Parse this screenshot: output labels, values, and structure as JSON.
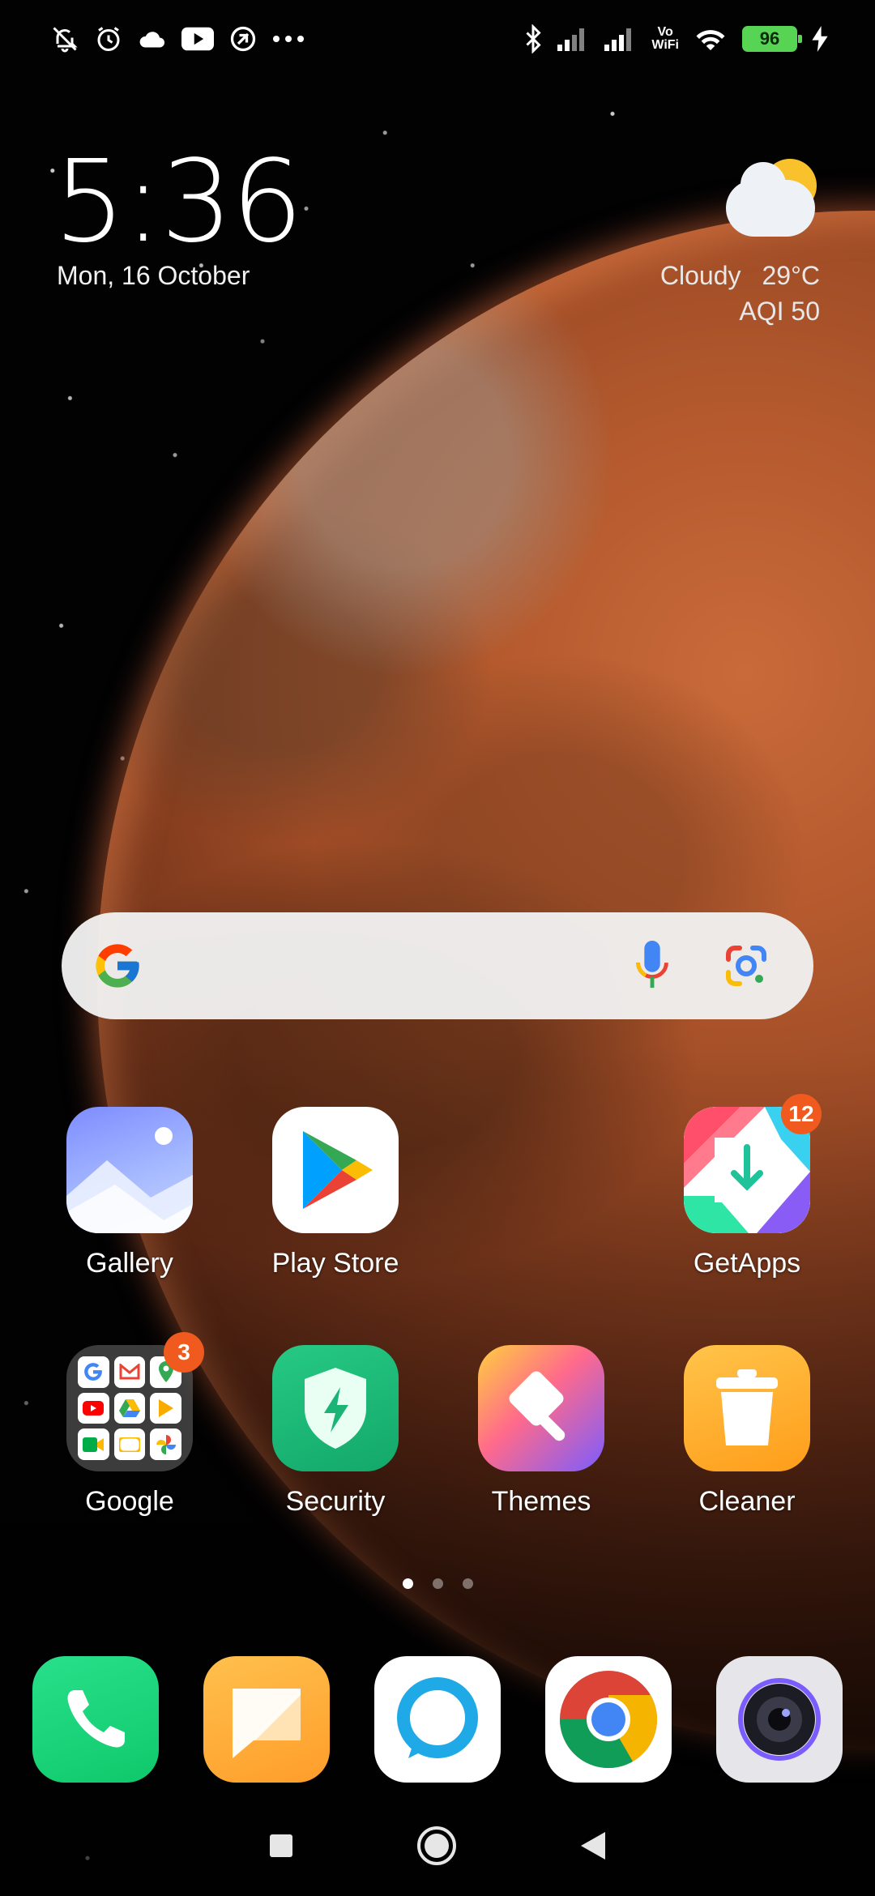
{
  "status_bar": {
    "left_icons": [
      "muted-bell-icon",
      "alarm-icon",
      "cloud-icon",
      "youtube-icon",
      "app-notification-icon",
      "more-dots-icon"
    ],
    "right_icons": [
      "bluetooth-icon",
      "signal-icon",
      "signal-icon",
      "vowifi-icon",
      "wifi-icon",
      "battery-icon",
      "charging-icon"
    ],
    "vowifi_top": "Vo",
    "vowifi_bottom": "WiFi",
    "battery_level": "96"
  },
  "clock_widget": {
    "time": "5:36",
    "date": "Mon, 16 October"
  },
  "weather_widget": {
    "condition": "Cloudy",
    "temperature": "29°C",
    "aqi": "AQI 50"
  },
  "search_bar": {
    "icons": [
      "google-g-icon",
      "microphone-icon",
      "google-lens-icon"
    ]
  },
  "apps_row1": [
    {
      "label": "Gallery"
    },
    {
      "label": "Play Store"
    },
    {
      "label": "GetApps",
      "badge": "12"
    }
  ],
  "apps_row2": [
    {
      "label": "Google",
      "badge": "3"
    },
    {
      "label": "Security"
    },
    {
      "label": "Themes"
    },
    {
      "label": "Cleaner"
    }
  ],
  "page_indicator": {
    "total": 3,
    "active": 1
  },
  "dock": [
    "phone-icon",
    "messages-icon",
    "alexa-icon",
    "chrome-icon",
    "camera-icon"
  ],
  "nav_bar": [
    "recents-button",
    "home-button",
    "back-button"
  ],
  "colors": {
    "badge": "#f05a1e",
    "battery": "#58d454",
    "planet": "#b55a2e"
  }
}
